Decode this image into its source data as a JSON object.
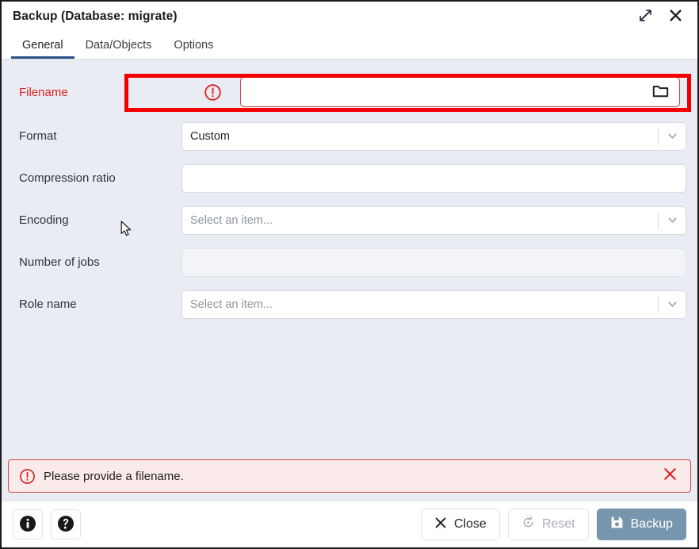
{
  "window": {
    "title": "Backup (Database: migrate)",
    "expand_label": "expand-icon",
    "close_label": "close-icon"
  },
  "tabs": [
    {
      "label": "General",
      "active": true
    },
    {
      "label": "Data/Objects",
      "active": false
    },
    {
      "label": "Options",
      "active": false
    }
  ],
  "form": {
    "filename": {
      "label": "Filename",
      "value": "",
      "placeholder": "",
      "has_error": true,
      "browse_icon": "folder-icon",
      "error_icon": "error-circle-icon"
    },
    "format": {
      "label": "Format",
      "value": "Custom",
      "type": "select"
    },
    "compression_ratio": {
      "label": "Compression ratio",
      "value": "",
      "type": "text"
    },
    "encoding": {
      "label": "Encoding",
      "value": "Select an item...",
      "type": "select",
      "is_placeholder": true
    },
    "number_of_jobs": {
      "label": "Number of jobs",
      "value": "",
      "type": "text",
      "disabled": true
    },
    "role_name": {
      "label": "Role name",
      "value": "Select an item...",
      "type": "select",
      "is_placeholder": true
    }
  },
  "alert": {
    "message": "Please provide a filename.",
    "icon": "error-circle-icon",
    "close_icon": "close-icon"
  },
  "footer": {
    "info_label": "info-icon",
    "help_label": "help-icon",
    "close_button": "Close",
    "reset_button": "Reset",
    "backup_button": "Backup"
  },
  "colors": {
    "error_red": "#e02020",
    "annotation_red": "#f20000",
    "tab_accent": "#2b5287",
    "primary_button": "#7895ae",
    "body_background": "#e9ecf2"
  }
}
